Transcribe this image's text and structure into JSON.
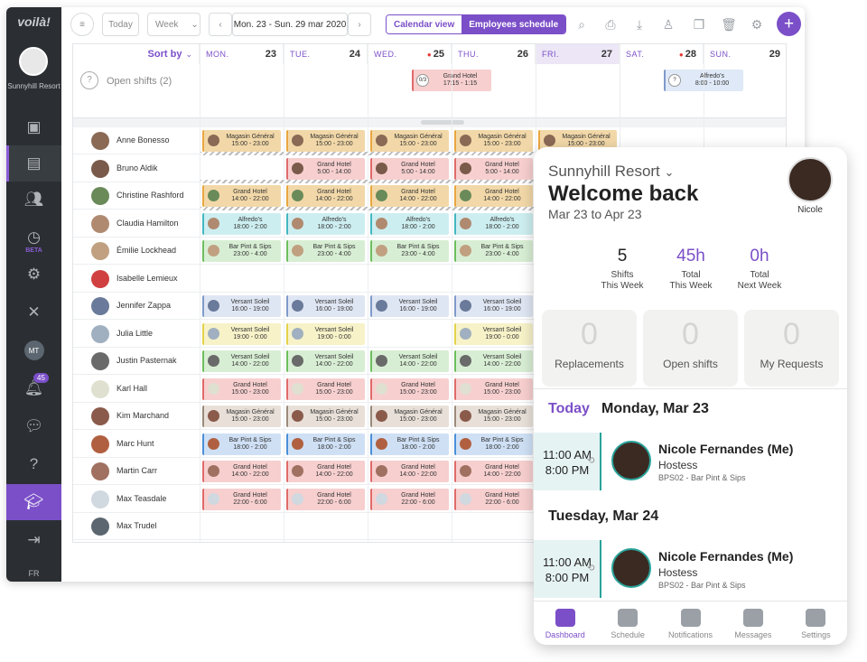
{
  "brand": {
    "logo": "voilà!",
    "org_name": "Sunnyhill Resort"
  },
  "nav": {
    "beta": "BETA",
    "user_initials": "MT",
    "notif_count": "45",
    "lang": "FR"
  },
  "toolbar": {
    "today": "Today",
    "view": "Week",
    "date_range": "Mon. 23 - Sun. 29 mar 2020",
    "calendar_view": "Calendar view",
    "employees_schedule": "Employees schedule",
    "add": "+"
  },
  "grid": {
    "sort_label": "Sort by",
    "open_shifts": "Open shifts (2)",
    "days": [
      {
        "dow": "MON.",
        "num": "23",
        "dot": false
      },
      {
        "dow": "TUE.",
        "num": "24",
        "dot": false
      },
      {
        "dow": "WED.",
        "num": "25",
        "dot": true
      },
      {
        "dow": "THU.",
        "num": "26",
        "dot": false
      },
      {
        "dow": "FRI.",
        "num": "27",
        "dot": false
      },
      {
        "dow": "SAT.",
        "num": "28",
        "dot": true
      },
      {
        "dow": "SUN.",
        "num": "29",
        "dot": false
      }
    ],
    "open_items": [
      {
        "day": 2,
        "count": "0/3",
        "name": "Grand Hotel",
        "time": "17:15 - 1:15"
      },
      {
        "day": 5,
        "count": "?",
        "name": "Alfredo's",
        "time": "8:00 - 10:00"
      }
    ],
    "employees": [
      {
        "name": "Anne Bonesso",
        "shift": "Magasin Général",
        "time": "15:00 - 23:00",
        "days": [
          0,
          1,
          2,
          3,
          4
        ],
        "color": "#f2d8a8",
        "bar": "#e9a640"
      },
      {
        "name": "Bruno Aldik",
        "shift": "Grand Hotel",
        "time": "5:00 - 14:00",
        "days": [
          1,
          2,
          3,
          4
        ],
        "color": "#f7cfcf",
        "bar": "#e06a6a"
      },
      {
        "name": "Christine Rashford",
        "shift": "Grand Hotel",
        "time": "14:00 - 22:00",
        "days": [
          0,
          1,
          2,
          3,
          4
        ],
        "color": "#f2d8a8",
        "bar": "#e9a640"
      },
      {
        "name": "Claudia Hamilton",
        "shift": "Alfredo's",
        "time": "18:00 - 2:00",
        "days": [
          0,
          1,
          2,
          3,
          4
        ],
        "color": "#cdeef0",
        "bar": "#43b7c2"
      },
      {
        "name": "Émilie Lockhead",
        "shift": "Bar Pint & Sips",
        "time": "23:00 - 4:00",
        "days": [
          0,
          1,
          2,
          3,
          4
        ],
        "color": "#d8eed4",
        "bar": "#6cbf5e"
      },
      {
        "name": "Isabelle Lemieux",
        "shift": "",
        "time": "",
        "days": [],
        "color": "#fff",
        "bar": "#fff"
      },
      {
        "name": "Jennifer Zappa",
        "shift": "Versant Soleil",
        "time": "16:00 - 19:00",
        "days": [
          0,
          1,
          2,
          3,
          4
        ],
        "color": "#dfe6f3",
        "bar": "#7f9acb"
      },
      {
        "name": "Julia Little",
        "shift": "Versant Soleil",
        "time": "19:00 - 0:00",
        "days": [
          0,
          1,
          3,
          4
        ],
        "color": "#f7f2c8",
        "bar": "#e4d24b"
      },
      {
        "name": "Justin Pasternak",
        "shift": "Versant Soleil",
        "time": "14:00 - 22:00",
        "days": [
          0,
          1,
          2,
          3,
          4
        ],
        "color": "#d8eed4",
        "bar": "#6cbf5e"
      },
      {
        "name": "Karl Hall",
        "shift": "Grand Hotel",
        "time": "15:00 - 23:00",
        "days": [
          0,
          1,
          2,
          3,
          4
        ],
        "color": "#f7cfcf",
        "bar": "#e06a6a"
      },
      {
        "name": "Kim Marchand",
        "shift": "Magasin Général",
        "time": "15:00 - 23:00",
        "days": [
          0,
          1,
          2,
          3,
          4
        ],
        "color": "#e8e0d8",
        "bar": "#9a8a7a"
      },
      {
        "name": "Marc Hunt",
        "shift": "Bar Pint & Sips",
        "time": "18:00 - 2:00",
        "days": [
          0,
          1,
          2,
          3,
          4
        ],
        "color": "#cfe0f5",
        "bar": "#4a8fd9"
      },
      {
        "name": "Martin Carr",
        "shift": "Grand Hotel",
        "time": "14:00 - 22:00",
        "days": [
          0,
          1,
          2,
          3,
          4
        ],
        "color": "#f7cfcf",
        "bar": "#e06a6a"
      },
      {
        "name": "Max Teasdale",
        "shift": "Grand Hotel",
        "time": "22:00 - 6:00",
        "days": [
          0,
          1,
          2,
          3,
          4
        ],
        "color": "#f7cfcf",
        "bar": "#e06a6a"
      },
      {
        "name": "Max Trudel",
        "shift": "",
        "time": "",
        "days": [],
        "color": "#fff",
        "bar": "#fff"
      }
    ]
  },
  "mobile": {
    "resort": "Sunnyhill Resort",
    "welcome": "Welcome back",
    "date_range": "Mar 23 to Apr 23",
    "user": "Nicole",
    "stats": [
      {
        "value": "5",
        "label1": "Shifts",
        "label2": "This Week"
      },
      {
        "value": "45h",
        "label1": "Total",
        "label2": "This Week"
      },
      {
        "value": "0h",
        "label1": "Total",
        "label2": "Next Week"
      }
    ],
    "cards": [
      {
        "value": "0",
        "label": "Replacements"
      },
      {
        "value": "0",
        "label": "Open shifts"
      },
      {
        "value": "0",
        "label": "My Requests"
      }
    ],
    "today": "Today",
    "day1": "Monday, Mar 23",
    "day2": "Tuesday, Mar 24",
    "shift": {
      "start": "11:00 AM",
      "end": "8:00 PM",
      "name": "Nicole Fernandes (Me)",
      "role": "Hostess",
      "location": "BPS02 - Bar Pint & Sips"
    },
    "tabs": [
      "Dashboard",
      "Schedule",
      "Notifications",
      "Messages",
      "Settings"
    ]
  }
}
